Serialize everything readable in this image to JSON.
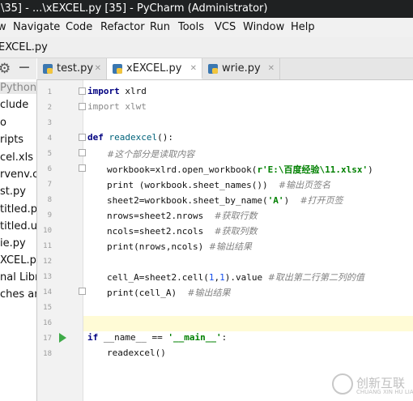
{
  "window": {
    "title": "\\35] - ...\\xEXCEL.py [35] - PyCharm (Administrator)"
  },
  "menu": [
    "Navigate",
    "Code",
    "Refactor",
    "Run",
    "Tools",
    "VCS",
    "Window",
    "Help"
  ],
  "menu_partial": "w",
  "breadcrumb": {
    "file": "EXCEL.py"
  },
  "project_items": [
    {
      "label": "PythonW",
      "selected": true
    },
    {
      "label": "clude"
    },
    {
      "label": "o"
    },
    {
      "label": "ripts"
    },
    {
      "label": "cel.xls"
    },
    {
      "label": "rvenv.cfg"
    },
    {
      "label": "st.py"
    },
    {
      "label": "titled.py"
    },
    {
      "label": "titled.ui"
    },
    {
      "label": "ie.py"
    },
    {
      "label": "XCEL.py"
    },
    {
      "label": "nal Libra"
    },
    {
      "label": "ches and"
    }
  ],
  "tabs": [
    {
      "label": "test.py",
      "active": false
    },
    {
      "label": "xEXCEL.py",
      "active": true
    },
    {
      "label": "wrie.py",
      "active": false
    }
  ],
  "line_numbers": [
    "1",
    "2",
    "3",
    "4",
    "5",
    "6",
    "7",
    "8",
    "9",
    "10",
    "11",
    "12",
    "13",
    "14",
    "15",
    "16",
    "17",
    "18"
  ],
  "code": {
    "l1_kw": "import",
    "l1_mod": " xlrd",
    "l2_kw": "import",
    "l2_mod": " xlwt",
    "l4_kw": "def",
    "l4_fn": " readexcel",
    "l4_rest": "():",
    "l5_cm": "#这个部分是读取内容",
    "l6_a": "workbook=xlrd.open_workbook(",
    "l6_str": "r'E:\\百度经验\\11.xlsx'",
    "l6_b": ")",
    "l7_a": "print (workbook.sheet_names())  ",
    "l7_cm": "#输出页签名",
    "l8_a": "sheet2=workbook.sheet_by_name(",
    "l8_str": "'A'",
    "l8_b": ")  ",
    "l8_cm": "#打开页签",
    "l9_a": "nrows=sheet2.nrows  ",
    "l9_cm": "#获取行数",
    "l10_a": "ncols=sheet2.ncols  ",
    "l10_cm": "#获取列数",
    "l11_a": "print(nrows,ncols) ",
    "l11_cm": "#输出结果",
    "l13_a": "cell_A=sheet2.cell(",
    "l13_n1": "1",
    "l13_c": ",",
    "l13_n2": "1",
    "l13_b": ").value ",
    "l13_cm": "#取出第二行第二列的值",
    "l14_a": "print(cell_A)  ",
    "l14_cm": "#输出结果",
    "l17_kw": "if",
    "l17_a": " __name__ == ",
    "l17_str": "'__main__'",
    "l17_b": ":",
    "l18_a": "readexcel()"
  },
  "watermark": {
    "brand": "创新互联",
    "sub": "CHUANG XIN HU LIAN"
  },
  "colors": {
    "titlebar": "#1f2122",
    "keyword": "#000080",
    "string": "#008000",
    "comment": "#808080",
    "run": "#3eaa48"
  }
}
